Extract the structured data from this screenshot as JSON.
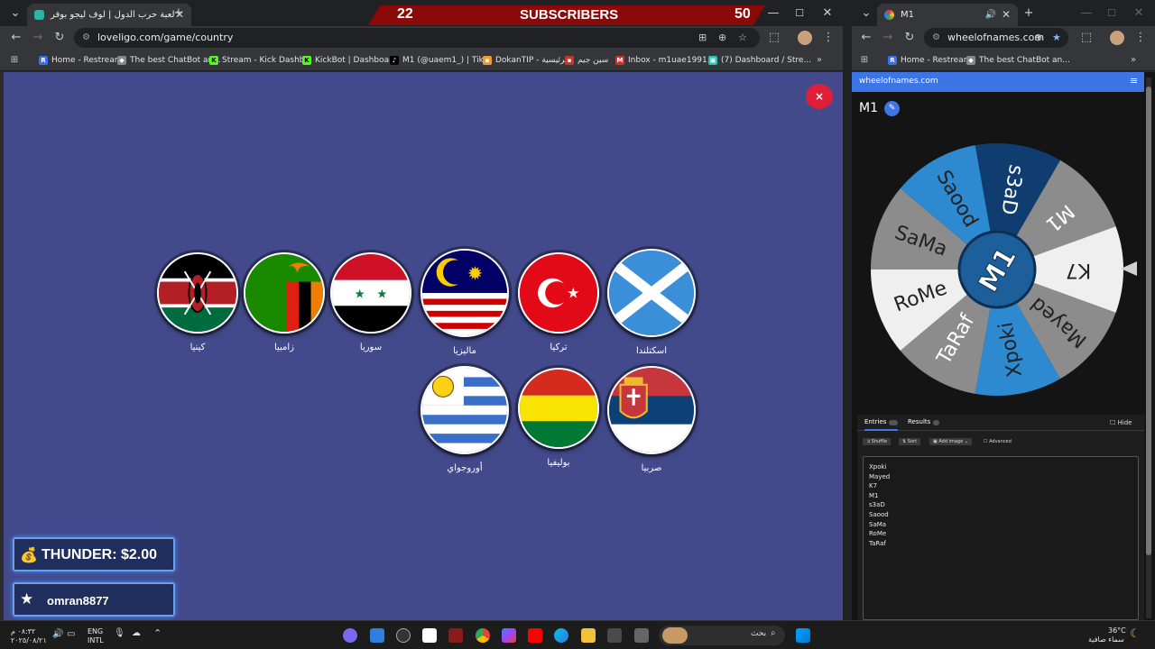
{
  "browser_left": {
    "tab_title": "لعبة حرب الدول | لوف ليجو بوفر",
    "url": "loveligo.com/game/country",
    "bookmarks": [
      "Home - Restream",
      "The best ChatBot an...",
      "Stream - Kick Dashb...",
      "KickBot | Dashboard",
      "M1 (@uaem1_) | Tik...",
      "DokanTIP - الرئيسية",
      "سين جيم",
      "Inbox - m1uae1991...",
      "(7) Dashboard / Stre..."
    ]
  },
  "overlay": {
    "count_left": "22",
    "label": "SUBSCRIBERS",
    "count_right": "50"
  },
  "game": {
    "countries": [
      {
        "name": "كينيا",
        "flag": "kenya"
      },
      {
        "name": "زامبيا",
        "flag": "zambia"
      },
      {
        "name": "سوريا",
        "flag": "syria"
      },
      {
        "name": "ماليزيا",
        "flag": "malaysia"
      },
      {
        "name": "تركيا",
        "flag": "turkey"
      },
      {
        "name": "اسكتلندا",
        "flag": "scotland"
      },
      {
        "name": "أوروجواي",
        "flag": "uruguay"
      },
      {
        "name": "بوليفيا",
        "flag": "bolivia"
      },
      {
        "name": "صربيا",
        "flag": "serbia"
      }
    ],
    "close_symbol": "×"
  },
  "alerts": [
    {
      "text": "THUNDER: $2.00",
      "icon": "money-bag-icon"
    },
    {
      "text": "omran8877",
      "icon": "star-icon"
    }
  ],
  "browser_right": {
    "tab_title": "M1",
    "url": "wheelofnames.com",
    "bookmarks": [
      "Home - Restream",
      "The best ChatBot an..."
    ],
    "site_header": "wheelofnames.com",
    "wheel_title": "M1",
    "wheel_center": "M1",
    "segments": [
      "s3aD",
      "M1",
      "K7",
      "Mayed",
      "Xpoki",
      "TaRaf",
      "RoMe",
      "SaMa",
      "Saood"
    ],
    "tabs": {
      "entries": "Entries",
      "entries_count": "10",
      "results": "Results",
      "results_count": "0"
    },
    "hide_label": "Hide",
    "tools": {
      "shuffle": "Shuffle",
      "sort": "Sort",
      "add_image": "Add image",
      "advanced": "Advanced"
    },
    "entries": [
      "Xpoki",
      "Mayed",
      "K7",
      "M1",
      "s3aD",
      "Saood",
      "SaMa",
      "RoMe",
      "TaRaf"
    ]
  },
  "taskbar": {
    "clock_time": "٠٨:٣٢ م",
    "clock_date": "٢٠٢٥/٠٨/٢١",
    "lang_1": "ENG",
    "lang_2": "INTL",
    "search_text": "بحث",
    "weather_temp": "36°C",
    "weather_desc": "سماء صافية"
  },
  "colors": {
    "game_bg": "#434a8b",
    "overlay_red": "#8a0a0a",
    "wheel_blue": "#2d8ad0",
    "wheel_navy": "#0f3d70",
    "wheel_gray": "#8c8c8c",
    "wheel_light": "#efefef",
    "close_red": "#e01e37",
    "site_blue": "#3d74e6"
  }
}
